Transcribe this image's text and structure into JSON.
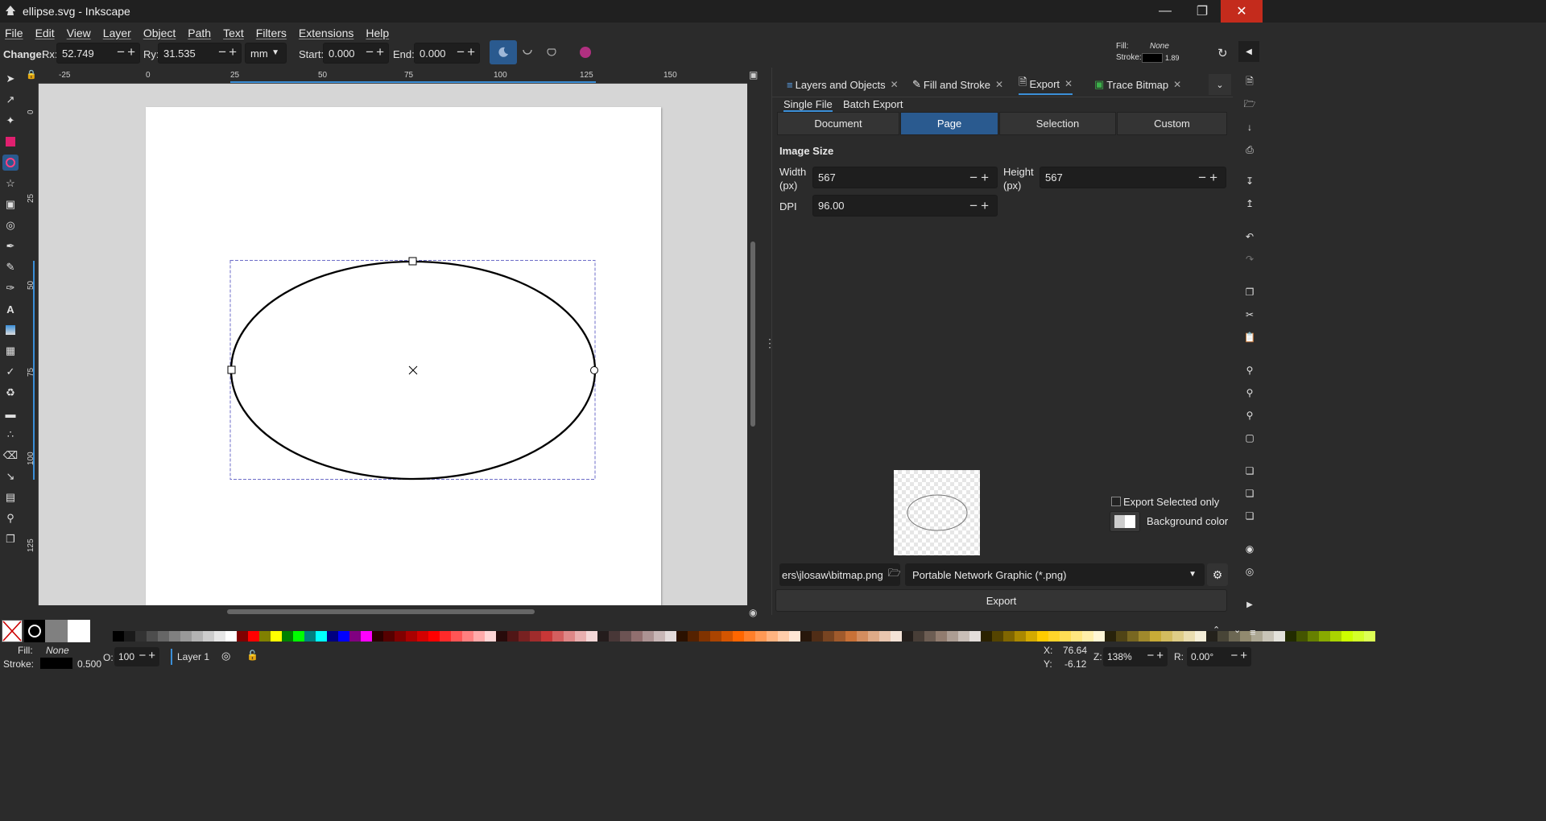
{
  "app": {
    "title": "ellipse.svg - Inkscape",
    "menu": [
      "File",
      "Edit",
      "View",
      "Layer",
      "Object",
      "Path",
      "Text",
      "Filters",
      "Extensions",
      "Help"
    ]
  },
  "toolbar": {
    "change_label": "Change:",
    "rx_label": "Rx:",
    "rx_value": "52.749",
    "ry_label": "Ry:",
    "ry_value": "31.535",
    "unit": "mm",
    "start_label": "Start:",
    "start_value": "0.000",
    "end_label": "End:",
    "end_value": "0.000",
    "fill_label": "Fill:",
    "fill_value": "None",
    "stroke_label": "Stroke:",
    "stroke_width": "1.89"
  },
  "rulers": {
    "horizontal": [
      "-25",
      "0",
      "25",
      "50",
      "75",
      "100",
      "125",
      "150"
    ],
    "vertical": [
      "0",
      "25",
      "50",
      "75",
      "100",
      "125"
    ]
  },
  "dock": {
    "tabs": [
      {
        "label": "Layers and Objects"
      },
      {
        "label": "Fill and Stroke"
      },
      {
        "label": "Export"
      },
      {
        "label": "Trace Bitmap"
      }
    ],
    "active_tab": "Export",
    "subtabs": [
      "Single File",
      "Batch Export"
    ],
    "area_buttons": [
      "Document",
      "Page",
      "Selection",
      "Custom"
    ],
    "active_area": "Page",
    "image_size_title": "Image Size",
    "width_label": "Width",
    "height_label": "Height",
    "px_label": "(px)",
    "width_value": "567",
    "height_value": "567",
    "dpi_label": "DPI",
    "dpi_value": "96.00",
    "export_selected_only": "Export Selected only",
    "background_color": "Background color",
    "file_path": "ers\\jlosaw\\bitmap.png",
    "file_type": "Portable Network Graphic (*.png)",
    "export_button": "Export"
  },
  "status": {
    "fill_label": "Fill:",
    "fill_value": "None",
    "stroke_label": "Stroke:",
    "stroke_width": "0.500",
    "opacity_label": "O:",
    "opacity_value": "100",
    "layer_name": "Layer 1",
    "x_label": "X:",
    "x_value": "76.64",
    "y_label": "Y:",
    "y_value": "-6.12",
    "zoom_label": "Z:",
    "zoom_value": "138%",
    "rotation_label": "R:",
    "rotation_value": "0.00°"
  },
  "colors": {
    "accent": "#2a5a8f",
    "close_red": "#c42b1c",
    "selection_purple": "#6e6ec8"
  },
  "palette": [
    "#000000",
    "#1a1a1a",
    "#333333",
    "#4d4d4d",
    "#666666",
    "#808080",
    "#999999",
    "#b3b3b3",
    "#cccccc",
    "#e6e6e6",
    "#ffffff",
    "#800000",
    "#ff0000",
    "#808000",
    "#ffff00",
    "#008000",
    "#00ff00",
    "#008080",
    "#00ffff",
    "#000080",
    "#0000ff",
    "#800080",
    "#ff00ff",
    "#2b0000",
    "#550000",
    "#800000",
    "#aa0000",
    "#d40000",
    "#ff0000",
    "#ff2a2a",
    "#ff5555",
    "#ff8080",
    "#ffaaaa",
    "#ffd5d5",
    "#280b0b",
    "#501616",
    "#782121",
    "#a02c2c",
    "#c83737",
    "#d35f5f",
    "#de8787",
    "#e9afaf",
    "#f4d7d7",
    "#241c1c",
    "#483737",
    "#6c5353",
    "#916f6f",
    "#ac9393",
    "#c8b7b7",
    "#e3dbdb",
    "#2b1100",
    "#552200",
    "#803300",
    "#aa4400",
    "#d45500",
    "#ff6600",
    "#ff7f2a",
    "#ff9955",
    "#ffb380",
    "#ffccaa",
    "#ffe6d5",
    "#28170b",
    "#502d16",
    "#784421",
    "#a05a2c",
    "#c87137",
    "#d38d5f",
    "#deaa87",
    "#e9c6af",
    "#f4e3d7",
    "#241f1c",
    "#483e37",
    "#6c5d53",
    "#917c6f",
    "#ac9d93",
    "#c8beb7",
    "#e3dedb",
    "#2b2200",
    "#554400",
    "#806600",
    "#aa8800",
    "#d4aa00",
    "#ffcc00",
    "#ffd42a",
    "#ffdd55",
    "#ffe680",
    "#ffeeaa",
    "#fff6d5",
    "#28220b",
    "#504416",
    "#786721",
    "#a0892c",
    "#c8ab37",
    "#d3bc5f",
    "#decd87",
    "#e9ddaf",
    "#f4eed7",
    "#24221c",
    "#484537",
    "#6c6753",
    "#918a6f",
    "#aca793",
    "#c8c4b7",
    "#e3e2db",
    "#222b00",
    "#445500",
    "#668000",
    "#88aa00",
    "#aad400",
    "#ccff00",
    "#d4ff2a",
    "#ddff55"
  ]
}
